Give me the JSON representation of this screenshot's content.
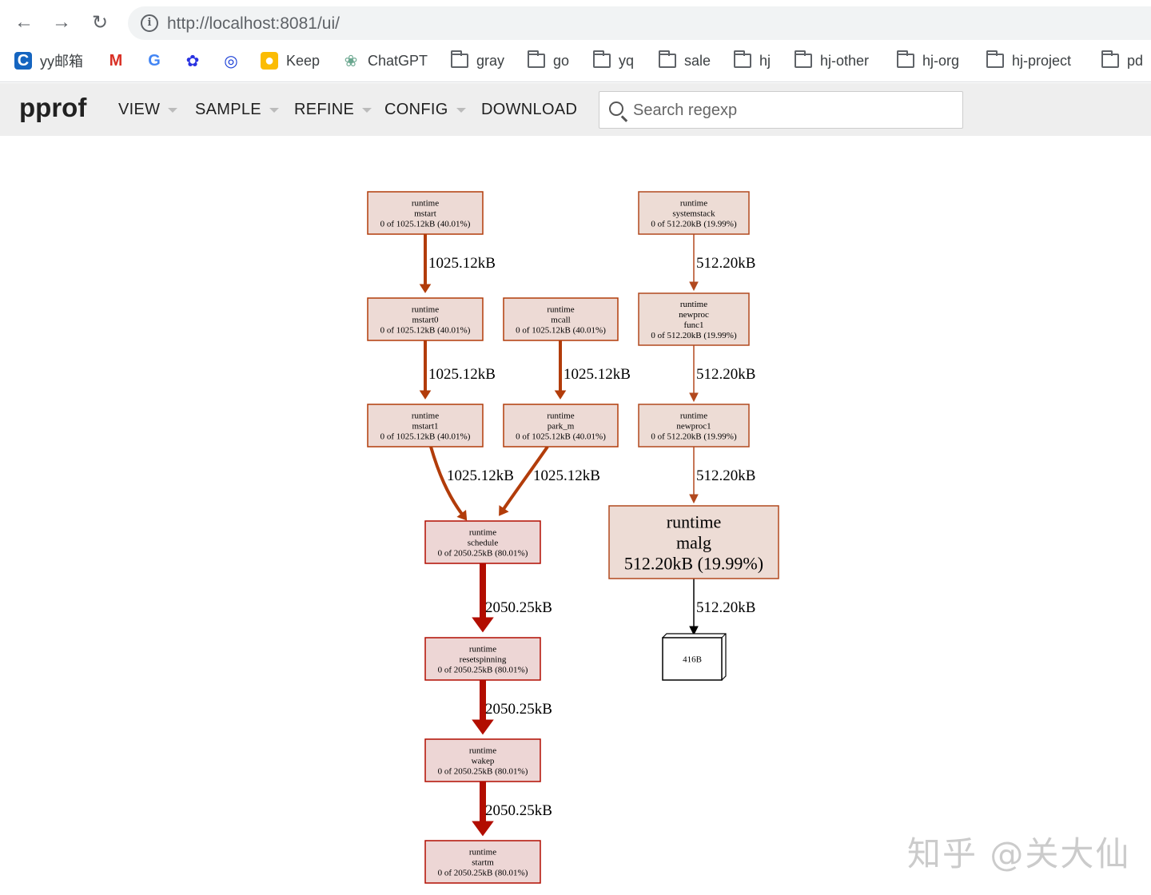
{
  "browser": {
    "url_host": "http://localhost",
    "url_rest": ":8081/ui/",
    "bookmarks": [
      {
        "label": "yy邮箱",
        "icon": "c-logo-icon"
      },
      {
        "label": "",
        "icon": "gmail-icon"
      },
      {
        "label": "",
        "icon": "google-icon"
      },
      {
        "label": "",
        "icon": "baidu-icon"
      },
      {
        "label": "",
        "icon": "target-icon"
      },
      {
        "label": "Keep",
        "icon": "keep-icon"
      },
      {
        "label": "ChatGPT",
        "icon": "chatgpt-icon"
      },
      {
        "label": "gray",
        "icon": "folder-icon"
      },
      {
        "label": "go",
        "icon": "folder-icon"
      },
      {
        "label": "yq",
        "icon": "folder-icon"
      },
      {
        "label": "sale",
        "icon": "folder-icon"
      },
      {
        "label": "hj",
        "icon": "folder-icon"
      },
      {
        "label": "hj-other",
        "icon": "folder-icon"
      },
      {
        "label": "hj-org",
        "icon": "folder-icon"
      },
      {
        "label": "hj-project",
        "icon": "folder-icon"
      },
      {
        "label": "pd",
        "icon": "folder-icon"
      }
    ]
  },
  "app": {
    "logo": "pprof",
    "menus": [
      "VIEW",
      "SAMPLE",
      "REFINE",
      "CONFIG",
      "DOWNLOAD"
    ],
    "search_placeholder": "Search regexp"
  },
  "graph": {
    "nodes": [
      {
        "id": "mstart",
        "lines": [
          "runtime",
          "mstart",
          "0 of 1025.12kB (40.01%)"
        ],
        "fill": "#eddad5",
        "stroke": "#b23c0a"
      },
      {
        "id": "mstart0",
        "lines": [
          "runtime",
          "mstart0",
          "0 of 1025.12kB (40.01%)"
        ],
        "fill": "#eddad5",
        "stroke": "#b23c0a"
      },
      {
        "id": "mstart1",
        "lines": [
          "runtime",
          "mstart1",
          "0 of 1025.12kB (40.01%)"
        ],
        "fill": "#eddad5",
        "stroke": "#b23c0a"
      },
      {
        "id": "mcall",
        "lines": [
          "runtime",
          "mcall",
          "0 of 1025.12kB (40.01%)"
        ],
        "fill": "#eddad5",
        "stroke": "#b23c0a"
      },
      {
        "id": "park_m",
        "lines": [
          "runtime",
          "park_m",
          "0 of 1025.12kB (40.01%)"
        ],
        "fill": "#eddad5",
        "stroke": "#b23c0a"
      },
      {
        "id": "schedule",
        "lines": [
          "runtime",
          "schedule",
          "0 of 2050.25kB (80.01%)"
        ],
        "fill": "#edd6d5",
        "stroke": "#b20d00"
      },
      {
        "id": "resetspinning",
        "lines": [
          "runtime",
          "resetspinning",
          "0 of 2050.25kB (80.01%)"
        ],
        "fill": "#edd6d5",
        "stroke": "#b20d00"
      },
      {
        "id": "wakep",
        "lines": [
          "runtime",
          "wakep",
          "0 of 2050.25kB (80.01%)"
        ],
        "fill": "#edd6d5",
        "stroke": "#b20d00"
      },
      {
        "id": "startm",
        "lines": [
          "runtime",
          "startm",
          "0 of 2050.25kB (80.01%)"
        ],
        "fill": "#edd6d5",
        "stroke": "#b20d00"
      },
      {
        "id": "systemstack",
        "lines": [
          "runtime",
          "systemstack",
          "0 of 512.20kB (19.99%)"
        ],
        "fill": "#eddcd5",
        "stroke": "#b2491e"
      },
      {
        "id": "newprocfunc1",
        "lines": [
          "runtime",
          "newproc",
          "func1",
          "0 of 512.20kB (19.99%)"
        ],
        "fill": "#eddcd5",
        "stroke": "#b2491e"
      },
      {
        "id": "newproc1",
        "lines": [
          "runtime",
          "newproc1",
          "0 of 512.20kB (19.99%)"
        ],
        "fill": "#eddcd5",
        "stroke": "#b2491e"
      },
      {
        "id": "malg",
        "lines": [
          "runtime",
          "malg",
          "512.20kB (19.99%)"
        ],
        "fill": "#eddcd5",
        "stroke": "#b2491e"
      },
      {
        "id": "b416",
        "lines": [
          "416B"
        ],
        "fill": "#ffffff",
        "stroke": "#000000"
      }
    ],
    "edges": [
      {
        "from": "mstart",
        "to": "mstart0",
        "label": "1025.12kB",
        "color": "#b23c0a"
      },
      {
        "from": "mstart0",
        "to": "mstart1",
        "label": "1025.12kB",
        "color": "#b23c0a"
      },
      {
        "from": "mcall",
        "to": "park_m",
        "label": "1025.12kB",
        "color": "#b23c0a"
      },
      {
        "from": "mstart1",
        "to": "schedule",
        "label": "1025.12kB",
        "color": "#b23c0a"
      },
      {
        "from": "park_m",
        "to": "schedule",
        "label": "1025.12kB",
        "color": "#b23c0a"
      },
      {
        "from": "schedule",
        "to": "resetspinning",
        "label": "2050.25kB",
        "color": "#b20d00"
      },
      {
        "from": "resetspinning",
        "to": "wakep",
        "label": "2050.25kB",
        "color": "#b20d00"
      },
      {
        "from": "wakep",
        "to": "startm",
        "label": "2050.25kB",
        "color": "#b20d00"
      },
      {
        "from": "systemstack",
        "to": "newprocfunc1",
        "label": "512.20kB",
        "color": "#b2491e"
      },
      {
        "from": "newprocfunc1",
        "to": "newproc1",
        "label": "512.20kB",
        "color": "#b2491e"
      },
      {
        "from": "newproc1",
        "to": "malg",
        "label": "512.20kB",
        "color": "#b2491e"
      },
      {
        "from": "malg",
        "to": "b416",
        "label": "512.20kB",
        "color": "#000000"
      }
    ]
  },
  "watermark": "知乎 @关大仙"
}
